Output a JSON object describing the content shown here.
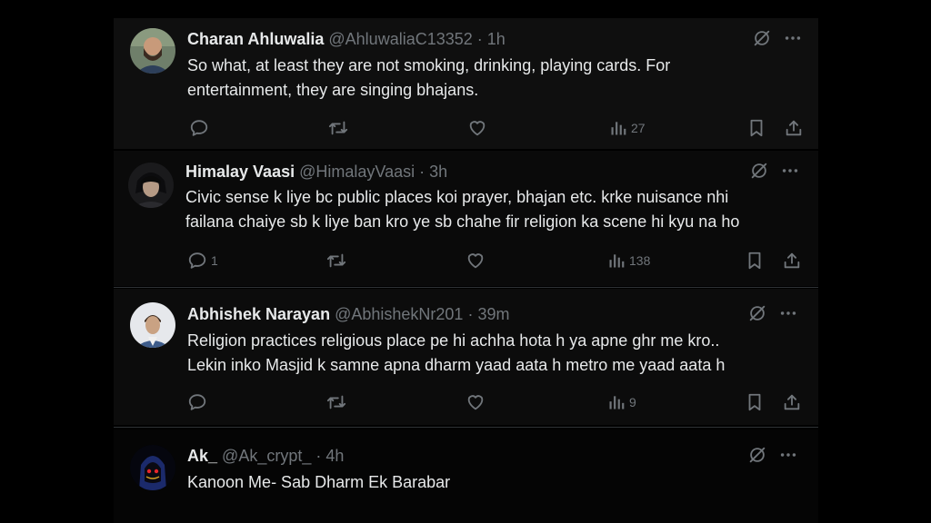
{
  "tweets": [
    {
      "name": "Charan Ahluwalia",
      "handle": "@AhluwaliaC13352",
      "dot": "·",
      "time": "1h",
      "lines": [
        "So what, at least they are not smoking, drinking, playing cards. For",
        "entertainment,  they are singing bhajans."
      ],
      "replies": "",
      "retweets": "",
      "likes": "",
      "views": "27"
    },
    {
      "name": "Himalay Vaasi",
      "handle": "@HimalayVaasi",
      "dot": "·",
      "time": "3h",
      "lines": [
        "Civic sense k liye bc public places koi prayer, bhajan etc.  krke nuisance nhi",
        "failana chaiye sb k liye ban kro ye sb chahe fir religion ka scene hi kyu na ho"
      ],
      "replies": "1",
      "retweets": "",
      "likes": "",
      "views": "138"
    },
    {
      "name": "Abhishek Narayan",
      "handle": "@AbhishekNr201",
      "dot": "·",
      "time": "39m",
      "lines": [
        "Religion practices religious place pe hi achha hota h ya apne ghr me kro..",
        "Lekin inko Masjid k samne apna dharm yaad aata h metro me yaad aata h"
      ],
      "replies": "",
      "retweets": "",
      "likes": "",
      "views": "9"
    },
    {
      "name": "Ak_",
      "handle": "@Ak_crypt_",
      "dot": "·",
      "time": "4h",
      "lines": [
        "Kanoon Me- Sab Dharm Ek Barabar"
      ]
    }
  ],
  "icons": {
    "grok": "grok-icon",
    "more": "more-icon",
    "reply": "reply-icon",
    "retweet": "retweet-icon",
    "like": "like-icon",
    "views": "views-icon",
    "bookmark": "bookmark-icon",
    "share": "share-icon"
  },
  "colors": {
    "background": "#000000",
    "text": "#e7e9ea",
    "secondary": "#71767b",
    "divider": "#2f3336"
  }
}
